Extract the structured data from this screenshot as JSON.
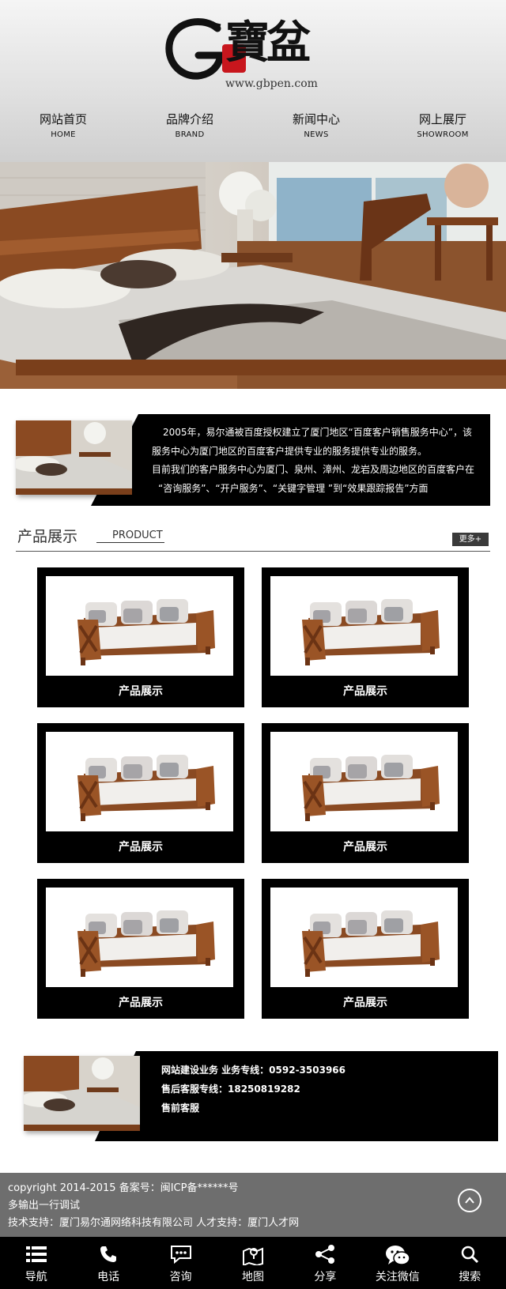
{
  "header": {
    "logo_letter": "G",
    "logo_chars": "寶盆",
    "logo_url": "www.gbpen.com"
  },
  "nav": [
    {
      "cn": "网站首页",
      "en": "HOME"
    },
    {
      "cn": "品牌介绍",
      "en": "BRAND"
    },
    {
      "cn": "新闻中心",
      "en": "NEWS"
    },
    {
      "cn": "网上展厅",
      "en": "SHOWROOM"
    }
  ],
  "about": {
    "lines": [
      "2005年，易尔通被百度授权建立了厦门地区“百度客户销售服务中心”，该",
      "服务中心为厦门地区的百度客户提供专业的服务提供专业的服务。",
      "目前我们的客户服务中心为厦门、泉州、漳州、龙岩及周边地区的百度客户在",
      "“咨询服务”、“开户服务”、“关键字管理 ”到“效果跟踪报告”方面"
    ]
  },
  "products": {
    "title": "产品展示",
    "title_en": "PRODUCT",
    "more": "更多+",
    "items": [
      {
        "label": "产品展示"
      },
      {
        "label": "产品展示"
      },
      {
        "label": "产品展示"
      },
      {
        "label": "产品展示"
      },
      {
        "label": "产品展示"
      },
      {
        "label": "产品展示"
      }
    ]
  },
  "contact": {
    "lines": [
      "网站建设业务 业务专线：0592-3503966",
      "售后客服专线：18250819282",
      "售前客服"
    ]
  },
  "footer": {
    "line1": "copyright 2014-2015 备案号：闽ICP备******号",
    "line2": "多输出一行调试",
    "line3": "技术支持：厦门易尔通网络科技有限公司 人才支持：厦门人才网"
  },
  "toolbar": [
    {
      "label": "导航",
      "icon": "menu-icon"
    },
    {
      "label": "电话",
      "icon": "phone-icon"
    },
    {
      "label": "咨询",
      "icon": "chat-icon"
    },
    {
      "label": "地图",
      "icon": "map-icon"
    },
    {
      "label": "分享",
      "icon": "share-icon"
    },
    {
      "label": "关注微信",
      "icon": "wechat-icon"
    },
    {
      "label": "搜索",
      "icon": "search-icon"
    }
  ]
}
